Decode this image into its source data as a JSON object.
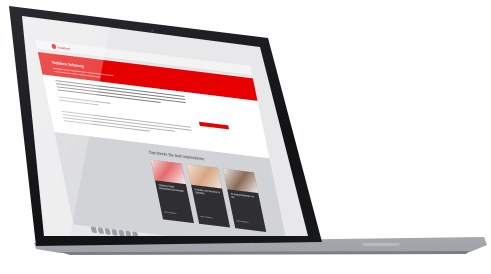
{
  "site": {
    "logo_text": "vodafone",
    "hero_title": "Vodafone Schulung",
    "section_title": "Das könnte Sie auch interessieren:",
    "cards": [
      {
        "title": "Vodafone Kabel Deutschland Schulungen",
        "link": "Mehr erfahren"
      },
      {
        "title": "Produkte und Services im Überblick",
        "link": "Mehr erfahren"
      },
      {
        "title": "Ihr Ansprechpartner vor Ort",
        "link": "Mehr erfahren"
      }
    ]
  },
  "colors": {
    "brand_red": "#e60000",
    "card_dark": "#2f2f33",
    "band_gray": "#d2d3d6"
  },
  "dock": {
    "icons": [
      "finder-icon",
      "browser-icon",
      "mail-icon",
      "calendar-icon",
      "notes-icon",
      "photos-icon",
      "music-icon"
    ]
  }
}
